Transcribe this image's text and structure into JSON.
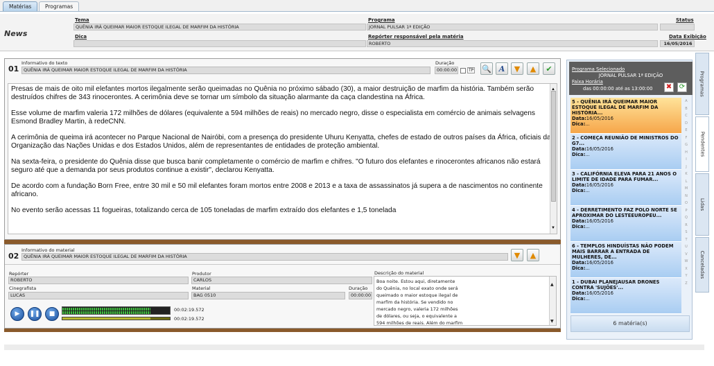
{
  "tabs": [
    "Matérias",
    "Programas"
  ],
  "header": {
    "section": "News",
    "tema_label": "Tema",
    "tema_value": "QUÊNIA IRÁ QUEIMAR MAIOR ESTOQUE ILEGAL DE MARFIM DA HISTÓRIA",
    "programa_label": "Programa",
    "programa_value": "JORNAL PULSAR 1ª EDIÇÃO",
    "status_label": "Status",
    "status_value": "",
    "dica_label": "Dica",
    "dica_value": "",
    "reporter_label": "Repórter responsável pela matéria",
    "reporter_value": "ROBERTO",
    "data_label": "Data Exibição",
    "data_value": "16/05/2016"
  },
  "text_panel": {
    "number": "01",
    "label": "Informativo do texto",
    "value": "QUÊNIA IRÁ QUEIMAR MAIOR ESTOQUE ILEGAL DE MARFIM DA HISTÓRIA",
    "duracao_label": "Duração",
    "duracao_value": "00:00:00",
    "tp_label": "TP",
    "paragraphs": [
      "Presas de mais de oito mil elefantes mortos ilegalmente serão queimadas no Quênia no próximo sábado (30), a maior destruição de marfim da história. Também serão destruídos chifres de 343 rinocerontes. A cerimônia deve se tornar um símbolo da situação alarmante da caça clandestina na África.",
      "Esse volume de marfim valeria 172 milhões de dólares (equivalente a 594 milhões de reais) no mercado negro, disse o especialista em comércio de animais selvagens Esmond Bradley Martin, à redeCNN.",
      "A cerimônia de queima irá acontecer no Parque Nacional de Nairóbi, com a presença do presidente Uhuru Kenyatta, chefes de estado de outros países da África, oficiais da Organização das Nações Unidas e dos Estados Unidos, além de representantes de entidades de proteção ambiental.",
      "Na sexta-feira, o presidente do Quênia disse que busca banir completamente o comércio de marfim e chifres. \"O futuro dos elefantes e rinocerontes africanos não estará seguro até que a demanda por seus produtos continue a existir\", declarou Kenyatta.",
      "De acordo com a fundação Born Free, entre 30 mil e 50 mil elefantes foram mortos entre 2008 e 2013 e a taxa de assassinatos já supera a de nascimentos no continente africano.",
      "No evento serão acessas 11 fogueiras, totalizando cerca de 105 toneladas de marfim extraído dos elefantes e 1,5 tonelada"
    ]
  },
  "material_panel": {
    "number": "02",
    "label": "Informativo do material",
    "value": "QUÊNIA IRÁ QUEIMAR MAIOR ESTOQUE ILEGAL DE MARFIM DA HISTÓRIA",
    "reporter_label": "Repórter",
    "reporter_value": "ROBERTO",
    "produtor_label": "Produtor",
    "produtor_value": "CARLOS",
    "cinegrafista_label": "Cinegrafista",
    "cinegrafista_value": "LUCAS",
    "material_label": "Material",
    "material_value": "BAG 0510",
    "duracao_label": "Duração",
    "duracao_value": "00:00:00",
    "descricao_label": "Descrição do material",
    "descricao_lines": [
      "Boa noite. Estou aqui, diretamente",
      "do Quênia, no local exato onde será",
      "queimado o maior estoque ilegal de",
      "marfim da história. Se vendido no",
      "mercado negro, valeria 172 milhões",
      "de dólares, ou seja, o equivalente a",
      "594 milhões de reais. Além do marfim"
    ],
    "time1": "00:02:19.572",
    "time2": "00:02:19.572",
    "level1": 0.82,
    "level2": 0.82
  },
  "sidebar": {
    "prog_sel_label": "Programa Selecionado",
    "prog_sel_value": "JORNAL PULSAR 1ª EDIÇÃO",
    "faixa_label": "Faixa Horária",
    "faixa_value": "das 00:00:00 até as 13:00:00",
    "items": [
      {
        "title": "5 - QUÊNIA IRÁ QUEIMAR MAIOR ESTOQUE ILEGAL DE MARFIM DA HISTÓRIA...",
        "data": "16/05/2016",
        "dica": "..."
      },
      {
        "title": "2 - COMEÇA REUNIÃO DE MINISTROS DO G7...",
        "data": "16/05/2016",
        "dica": "..."
      },
      {
        "title": "3 - CALIFÓRNIA ELEVA PARA 21 ANOS O LIMITE DE IDADE PARA FUMAR...",
        "data": "16/05/2016",
        "dica": "..."
      },
      {
        "title": "4 - DERRETIMENTO FAZ POLO NORTE SE APROXIMAR DO LESTEEUROPEU...",
        "data": "16/05/2016",
        "dica": "..."
      },
      {
        "title": "6 - TEMPLOS HINDUÍSTAS NÃO PODEM MAIS BARRAR A ENTRADA DE MULHERES, DE...",
        "data": "16/05/2016",
        "dica": "..."
      },
      {
        "title": "1 - DUBAI PLANEJAUSAR DRONES CONTRA 'SUJÕES'...",
        "data": "16/05/2016",
        "dica": "..."
      }
    ],
    "data_label": "Data:",
    "dica_label": "Dica:",
    "footer": "6 matéria(s)",
    "alpha": [
      "A",
      "B",
      "C",
      "D",
      "E",
      "F",
      "G",
      "H",
      "I",
      "J",
      "K",
      "L",
      "M",
      "N",
      "O",
      "P",
      "Q",
      "R",
      "S",
      "T",
      "U",
      "V",
      "W",
      "X",
      "Y",
      "Z"
    ]
  },
  "vtabs": [
    "Programas",
    "Pendentes",
    "Lidas",
    "Canceladas"
  ]
}
